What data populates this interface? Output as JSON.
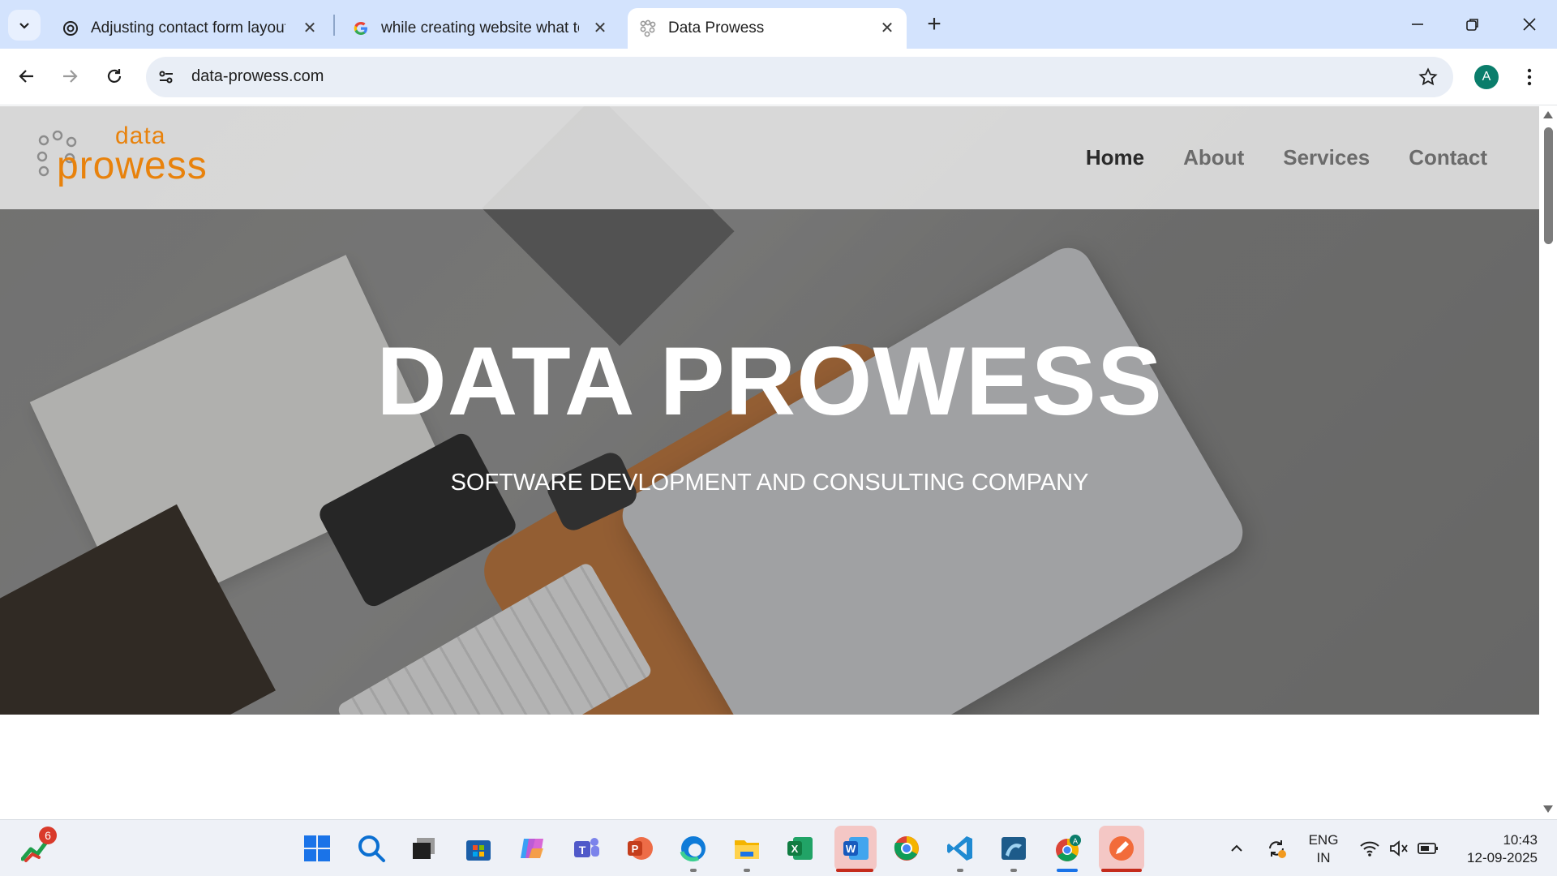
{
  "browser": {
    "tabs": [
      {
        "title": "Adjusting contact form layout",
        "favicon": "chatgpt-icon",
        "active": false
      },
      {
        "title": "while creating website what to d",
        "favicon": "google-icon",
        "active": false
      },
      {
        "title": "Data Prowess",
        "favicon": "data-prowess-icon",
        "active": true
      }
    ],
    "url": "data-prowess.com",
    "profile_initial": "A"
  },
  "site": {
    "logo": {
      "line1": "data",
      "line2": "prowess",
      "color": "#e8820c"
    },
    "nav": [
      {
        "label": "Home",
        "active": true
      },
      {
        "label": "About",
        "active": false
      },
      {
        "label": "Services",
        "active": false
      },
      {
        "label": "Contact",
        "active": false
      }
    ],
    "hero": {
      "title": "DATA PROWESS",
      "subtitle": "SOFTWARE DEVLOPMENT AND CONSULTING COMPANY"
    }
  },
  "taskbar": {
    "widgets_badge": "6",
    "apps": [
      "start-icon",
      "search-icon",
      "task-view-icon",
      "microsoft-store-icon",
      "copilot-icon",
      "teams-icon",
      "powerpoint-icon",
      "edge-icon",
      "file-explorer-icon",
      "excel-icon",
      "word-icon",
      "chrome-icon",
      "vscode-icon",
      "mysql-workbench-icon",
      "chrome-profile-icon",
      "pen-tool-icon"
    ],
    "language": {
      "line1": "ENG",
      "line2": "IN"
    },
    "time": "10:43",
    "date": "12-09-2025"
  }
}
